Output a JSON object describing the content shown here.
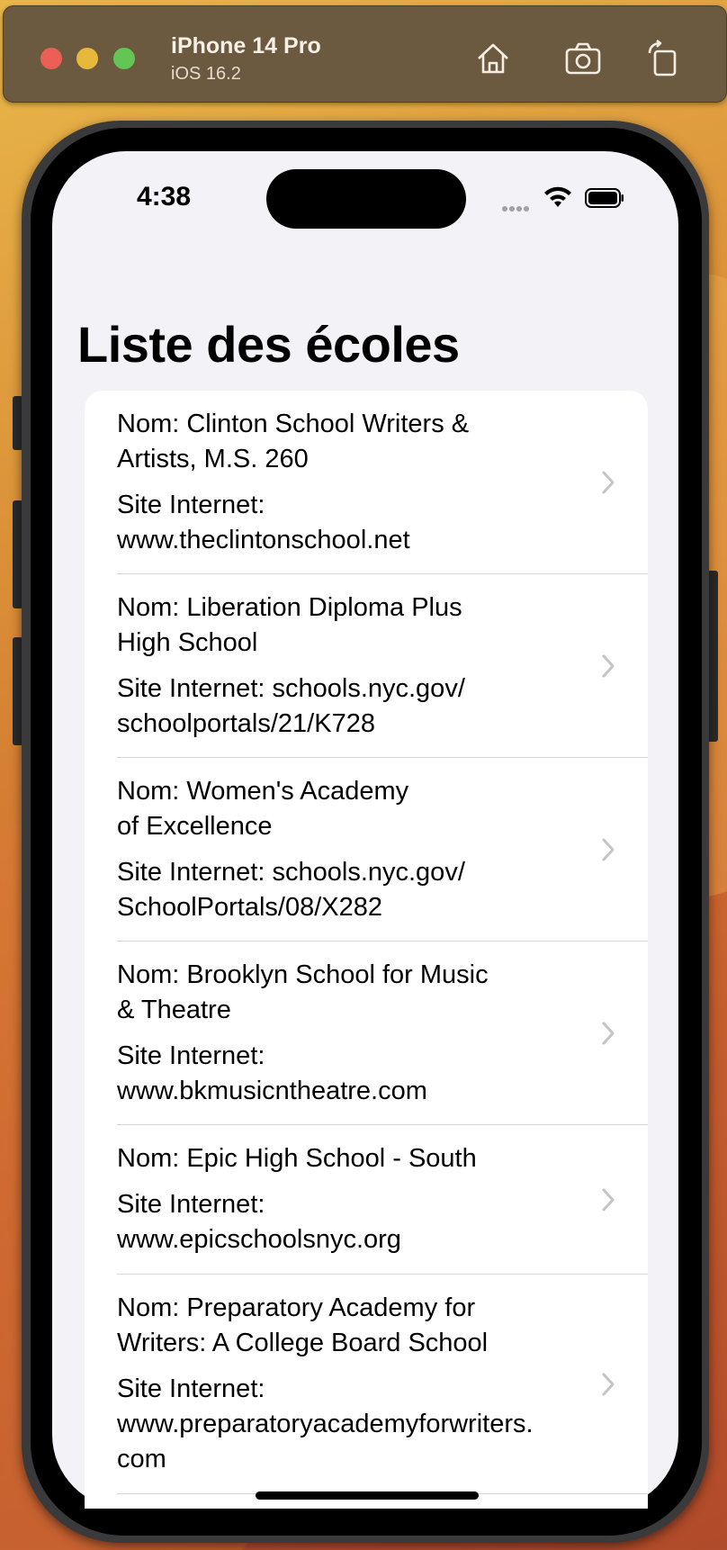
{
  "simulator": {
    "device_name": "iPhone 14 Pro",
    "os_version": "iOS 16.2",
    "icons": [
      "home-icon",
      "screenshot-icon",
      "rotate-icon"
    ]
  },
  "status_bar": {
    "time": "4:38"
  },
  "page": {
    "title": "Liste des écoles"
  },
  "schools": [
    {
      "name_lines": [
        "Nom: Clinton School Writers &",
        "Artists, M.S. 260"
      ],
      "site_lines": [
        "Site Internet:",
        "www.theclintonschool.net"
      ]
    },
    {
      "name_lines": [
        "Nom: Liberation Diploma Plus",
        "High School"
      ],
      "site_lines": [
        "Site Internet: schools.nyc.gov/",
        "schoolportals/21/K728"
      ]
    },
    {
      "name_lines": [
        "Nom: Women's Academy",
        "of Excellence"
      ],
      "site_lines": [
        "Site Internet: schools.nyc.gov/",
        "SchoolPortals/08/X282"
      ]
    },
    {
      "name_lines": [
        "Nom: Brooklyn School for Music",
        "& Theatre"
      ],
      "site_lines": [
        "Site Internet:",
        "www.bkmusicntheatre.com"
      ]
    },
    {
      "name_lines": [
        "Nom: Epic High School - South"
      ],
      "site_lines": [
        "Site Internet:",
        "www.epicschoolsnyc.org"
      ]
    },
    {
      "name_lines": [
        "Nom: Preparatory Academy for",
        "Writers: A College Board School"
      ],
      "site_lines": [
        "Site Internet:",
        "www.preparatoryacademyforwriters.",
        "com"
      ]
    }
  ],
  "colors": {
    "list_background": "#ffffff",
    "screen_background": "#f2f2f7",
    "chevron": "#c4c4c7",
    "divider": "#d8d8dc"
  }
}
